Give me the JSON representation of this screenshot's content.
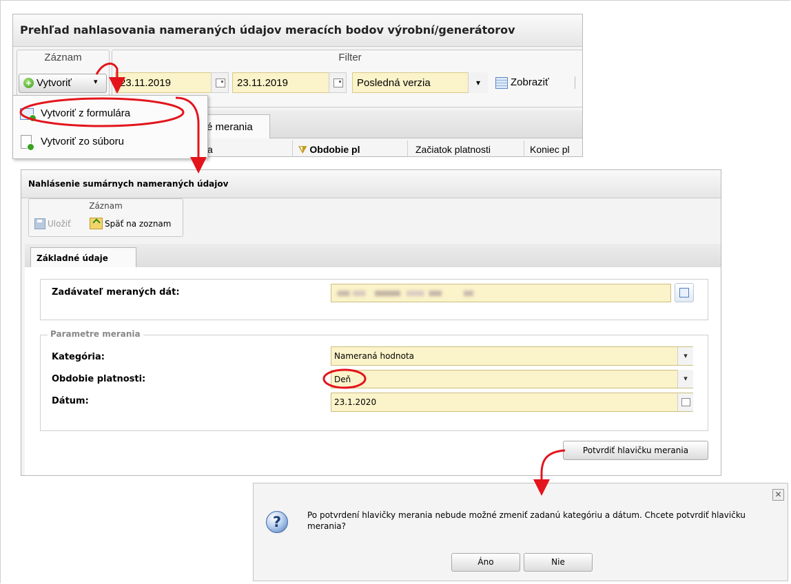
{
  "window1": {
    "title": "Prehľad nahlasovania nameraných údajov meracích bodov výrobní/generátorov",
    "record_group_label": "Záznam",
    "filter_group_label": "Filter",
    "create_button": "Vytvoriť",
    "date_from": "23.11.2019",
    "date_to": "23.11.2019",
    "version_select": "Posledná verzia",
    "show_button": "Zobraziť",
    "tab_partial": "é merania",
    "columns": [
      "a",
      "Obdobie pl",
      "Začiatok platnosti",
      "Koniec pl"
    ],
    "menu": [
      "Vytvoriť z formulára",
      "Vytvoriť zo súboru"
    ]
  },
  "window2": {
    "title": "Nahlásenie sumárnych nameraných údajov",
    "record_group_label": "Záznam",
    "save_button": "Uložiť",
    "back_button": "Späť na zoznam",
    "tab": "Základné údaje",
    "submitter_label": "Zadávateľ meraných dát:",
    "params_legend": "Parametre merania",
    "category_label": "Kategória:",
    "category_value": "Nameraná hodnota",
    "period_label": "Obdobie platnosti:",
    "period_value": "Deň",
    "date_label": "Dátum:",
    "date_value": "23.1.2020",
    "confirm_button": "Potvrdiť hlavičku merania"
  },
  "dialog": {
    "message": "Po potvrdení hlavičky merania nebude možné zmeniť zadanú kategóriu a dátum. Chcete potvrdiť hlavičku merania?",
    "yes_button": "Áno",
    "no_button": "Nie",
    "close_symbol": "✕"
  },
  "colors": {
    "annotation": "#e3141c",
    "input_bg": "#fbf3c9"
  }
}
